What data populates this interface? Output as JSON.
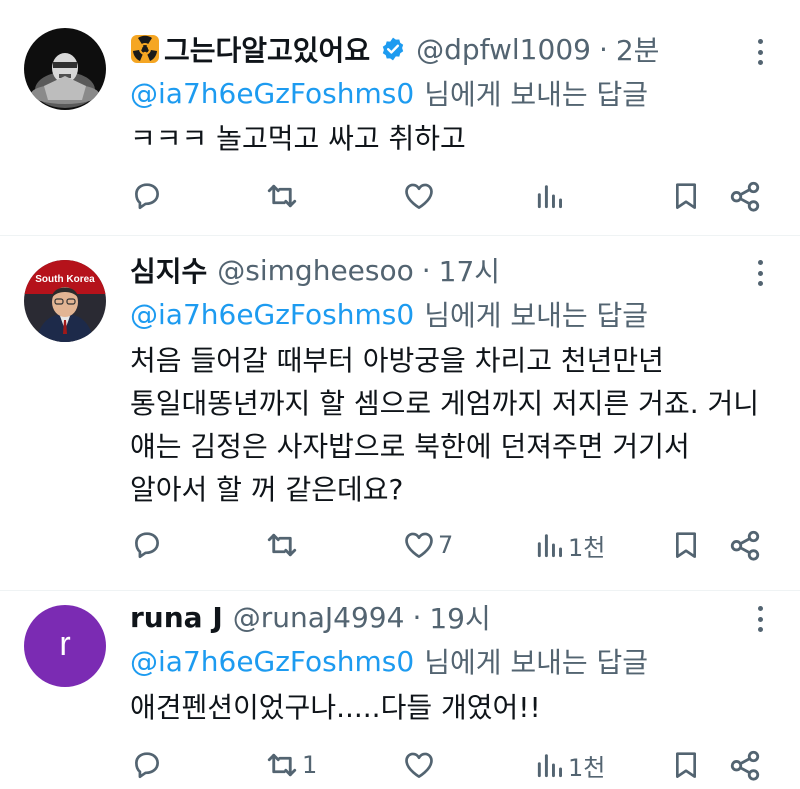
{
  "tweets": [
    {
      "name": "그는다알고있어요",
      "handle": "@dpfwl1009",
      "separator": "·",
      "time": "2분",
      "mention": "@ia7h6eGzFoshms0",
      "reply_suffix": "님에게 보내는 답글",
      "text_lines": [
        "ㅋㅋㅋ 놀고먹고 싸고 취하고"
      ],
      "likes": "",
      "retweets": "",
      "views": ""
    },
    {
      "name": "심지수",
      "handle": "@simgheesoo",
      "separator": "·",
      "time": "17시",
      "mention": "@ia7h6eGzFoshms0",
      "reply_suffix": "님에게 보내는 답글",
      "avatar_banner": "South Korea",
      "text_lines": [
        "처음 들어갈 때부터 아방궁을 차리고 천년만년",
        "통일대똥년까지 할 셈으로 게엄까지 저지른 거죠. 거니",
        "얘는 김정은 사자밥으로 북한에 던져주면 거기서",
        "알아서 할 꺼 같은데요?"
      ],
      "likes": "7",
      "retweets": "",
      "views": "1천"
    },
    {
      "name": "runa J",
      "handle": "@runaJ4994",
      "separator": "·",
      "time": "19시",
      "mention": "@ia7h6eGzFoshms0",
      "reply_suffix": "님에게 보내는 답글",
      "avatar_letter": "r",
      "text_lines": [
        "애견펜션이었구나.....다들 개였어!!"
      ],
      "likes": "",
      "retweets": "1",
      "views": "1천"
    }
  ],
  "icons": {
    "reply": "reply-icon",
    "retweet": "retweet-icon",
    "like": "heart-icon",
    "views": "views-icon",
    "bookmark": "bookmark-icon",
    "share": "share-icon",
    "more": "more-icon",
    "verified": "verified-badge-icon",
    "radiation": "radiation-icon"
  },
  "colors": {
    "accent": "#1d9bf0",
    "secondary_text": "#536471",
    "purple_avatar": "#7b2bb3",
    "verified": "#1d9bf0"
  }
}
